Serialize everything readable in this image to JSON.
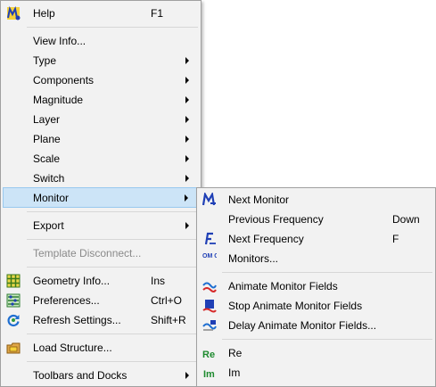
{
  "main_menu": {
    "help": {
      "label": "Help",
      "shortcut": "F1"
    },
    "view_info": {
      "label": "View Info..."
    },
    "type": {
      "label": "Type"
    },
    "components": {
      "label": "Components"
    },
    "magnitude": {
      "label": "Magnitude"
    },
    "layer": {
      "label": "Layer"
    },
    "plane": {
      "label": "Plane"
    },
    "scale": {
      "label": "Scale"
    },
    "switch": {
      "label": "Switch"
    },
    "monitor": {
      "label": "Monitor"
    },
    "export": {
      "label": "Export"
    },
    "template_disconnect": {
      "label": "Template Disconnect..."
    },
    "geometry_info": {
      "label": "Geometry Info...",
      "shortcut": "Ins"
    },
    "preferences": {
      "label": "Preferences...",
      "shortcut": "Ctrl+O"
    },
    "refresh_settings": {
      "label": "Refresh Settings...",
      "shortcut": "Shift+R"
    },
    "load_structure": {
      "label": "Load Structure..."
    },
    "toolbars_docks": {
      "label": "Toolbars and Docks"
    }
  },
  "monitor_submenu": {
    "next_monitor": {
      "label": "Next  Monitor"
    },
    "previous_frequency": {
      "label": "Previous Frequency",
      "shortcut": "Down"
    },
    "next_frequency": {
      "label": "Next Frequency",
      "shortcut": "F"
    },
    "monitors": {
      "label": "Monitors..."
    },
    "animate": {
      "label": "Animate Monitor Fields"
    },
    "stop_animate": {
      "label": "Stop Animate Monitor Fields"
    },
    "delay_animate": {
      "label": "Delay Animate Monitor Fields..."
    },
    "re": {
      "label": "Re",
      "icon_text": "Re"
    },
    "im": {
      "label": "Im",
      "icon_text": "Im"
    }
  },
  "icon_text": {
    "monitors_icon": "OM OF"
  },
  "colors": {
    "menu_bg": "#f2f2f2",
    "highlight": "#cce4f7",
    "highlight_border": "#99c9ef",
    "disabled_text": "#8a8a8a",
    "icon_blue": "#1f3fb5",
    "icon_green": "#1d8a2e"
  }
}
